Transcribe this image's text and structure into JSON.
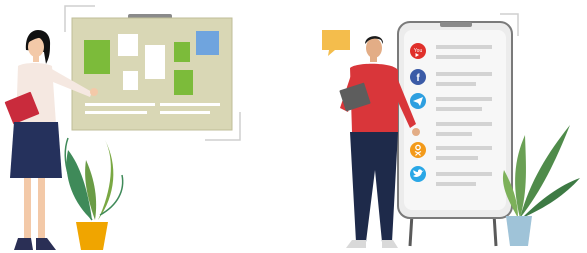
{
  "illustration": {
    "left_scene": {
      "board_color": "#d9d7b5",
      "sticky_colors": [
        "#7cbb3a",
        "#ffffff",
        "#6fa4de"
      ]
    },
    "right_scene": {
      "app_badges": [
        {
          "icon": "youtube-icon",
          "label": "You",
          "color": "#e0302b"
        },
        {
          "icon": "facebook-icon",
          "label": "f",
          "color": "#3b5ba7"
        },
        {
          "icon": "telegram-icon",
          "label": "",
          "color": "#2e9fe0"
        },
        {
          "icon": "odnoklassniki-icon",
          "label": "",
          "color": "#f39a1a"
        },
        {
          "icon": "twitter-icon",
          "label": "",
          "color": "#2aa7e6"
        }
      ]
    }
  }
}
